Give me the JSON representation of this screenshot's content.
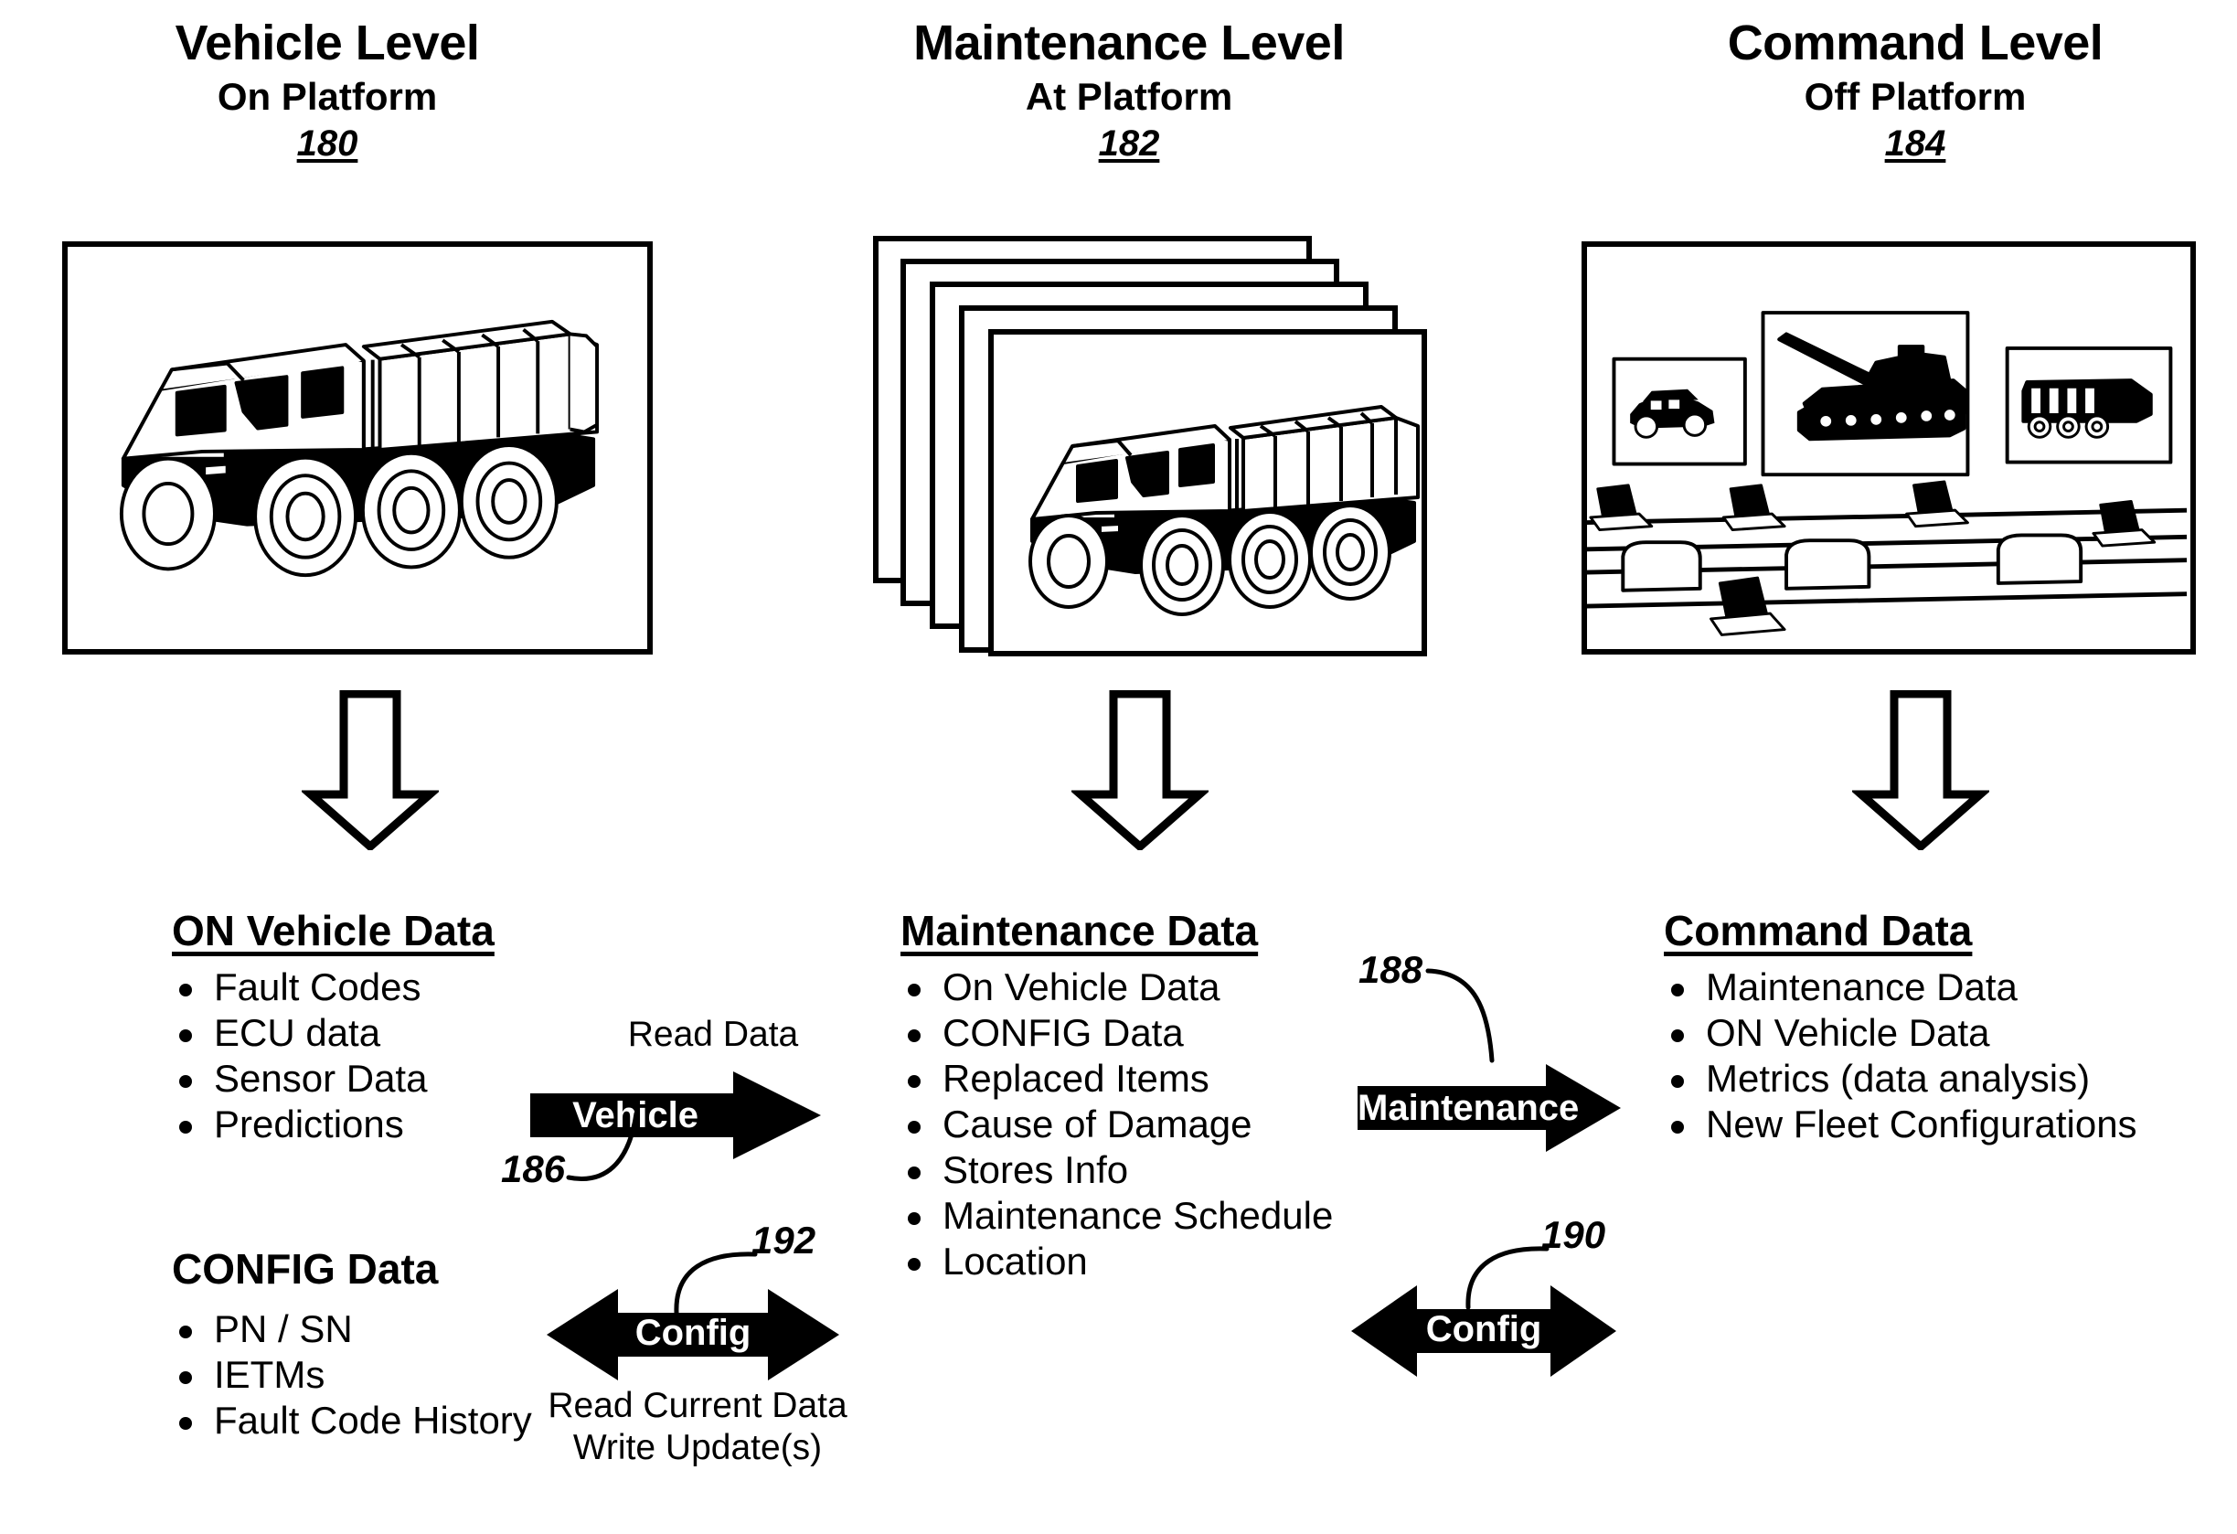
{
  "columns": [
    {
      "title": "Vehicle Level",
      "subtitle": "On Platform",
      "ref": "180",
      "image": "military-cargo-truck"
    },
    {
      "title": "Maintenance Level",
      "subtitle": "At Platform",
      "ref": "182",
      "image": "stacked-truck-records"
    },
    {
      "title": "Command Level",
      "subtitle": "Off Platform",
      "ref": "184",
      "image": "command-center-room"
    }
  ],
  "data_blocks": {
    "on_vehicle": {
      "title": "ON Vehicle Data",
      "items": [
        "Fault Codes",
        "ECU data",
        "Sensor Data",
        "Predictions"
      ]
    },
    "config": {
      "title": "CONFIG Data",
      "items": [
        "PN / SN",
        "IETMs",
        "Fault Code History"
      ]
    },
    "maintenance": {
      "title": "Maintenance Data",
      "items": [
        "On Vehicle Data",
        "CONFIG Data",
        "Replaced Items",
        "Cause of Damage",
        "Stores Info",
        "Maintenance Schedule",
        "Location"
      ]
    },
    "command": {
      "title": "Command Data",
      "items": [
        "Maintenance Data",
        "ON Vehicle Data",
        "Metrics (data analysis)",
        "New Fleet Configurations"
      ]
    }
  },
  "arrows": {
    "vehicle": {
      "label": "Vehicle",
      "caption_above": "Read Data",
      "ref": "186",
      "direction": "right"
    },
    "config_left": {
      "label": "Config",
      "caption_below_line1": "Read Current Data",
      "caption_below_line2": "Write Update(s)",
      "ref": "192",
      "direction": "both"
    },
    "maintenance": {
      "label": "Maintenance",
      "ref": "188",
      "direction": "right"
    },
    "config_right": {
      "label": "Config",
      "ref": "190",
      "direction": "both"
    }
  },
  "colors": {
    "ink": "#000000",
    "paper": "#ffffff"
  }
}
